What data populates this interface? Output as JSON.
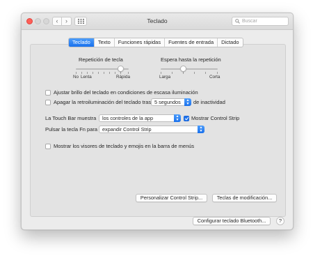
{
  "window": {
    "title": "Teclado",
    "search_placeholder": "Buscar"
  },
  "tabs": [
    {
      "label": "Teclado",
      "active": true
    },
    {
      "label": "Texto",
      "active": false
    },
    {
      "label": "Funciones rápidas",
      "active": false
    },
    {
      "label": "Fuentes de entrada",
      "active": false
    },
    {
      "label": "Dictado",
      "active": false
    }
  ],
  "key_repeat": {
    "title": "Repetición de tecla",
    "min_label": "No",
    "low_label": "Lenta",
    "max_label": "Rápida",
    "level": 0.85
  },
  "repeat_delay": {
    "title": "Espera hasta la repetición",
    "min_label": "Larga",
    "max_label": "Corta",
    "level": 0.4
  },
  "options": {
    "adjust_brightness": {
      "label": "Ajustar brillo del teclado en condiciones de escasa iluminación",
      "checked": false
    },
    "backlight_off_prefix": "Apagar la retroiluminación del teclado tras",
    "backlight_off_value": "5 segundos",
    "backlight_off_suffix": "de inactividad",
    "backlight_off_checked": false
  },
  "touchbar": {
    "shows_label": "La Touch Bar muestra",
    "shows_value": "los controles de la app",
    "control_strip_label": "Mostrar Control Strip",
    "control_strip_checked": true,
    "fn_label": "Pulsar la tecla Fn para",
    "fn_value": "expandir Control Strip"
  },
  "viewers": {
    "label": "Mostrar los visores de teclado y emojis en la barra de menús",
    "checked": false
  },
  "buttons": {
    "customize_strip": "Personalizar Control Strip...",
    "modifier_keys": "Teclas de modificación...",
    "bluetooth": "Configurar teclado Bluetooth...",
    "help": "?"
  },
  "colors": {
    "accent": "#1f74ee",
    "close_button": "#fe5f57"
  }
}
